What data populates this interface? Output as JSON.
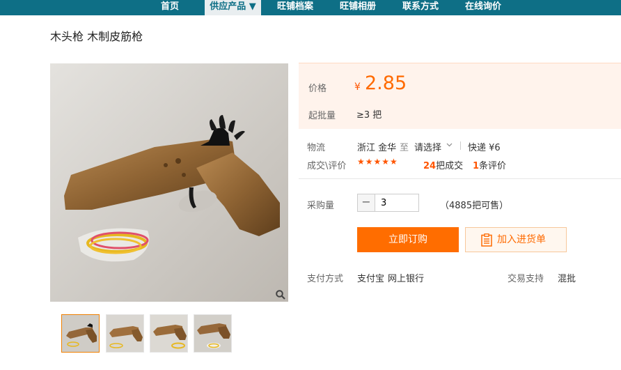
{
  "nav": {
    "items": [
      {
        "label": "首页"
      },
      {
        "label": "供应产品 ▼"
      },
      {
        "label": "旺铺档案"
      },
      {
        "label": "旺铺相册"
      },
      {
        "label": "联系方式"
      },
      {
        "label": "在线询价"
      }
    ],
    "active_index": 1
  },
  "product": {
    "title": "木头枪 木制皮筋枪"
  },
  "price": {
    "label": "价格",
    "currency": "¥",
    "value": "2.85",
    "moq_label": "起批量",
    "moq_value": "≥3 把"
  },
  "logistics": {
    "label": "物流",
    "from": "浙江 金华",
    "to_word": "至",
    "select_placeholder": "请选择",
    "shipping": "快递 ¥6"
  },
  "deals": {
    "label": "成交\\评价",
    "rating_stars": 5,
    "stars_text": "★★★★★",
    "sold_count": "24",
    "sold_suffix": "把成交",
    "review_count": "1",
    "review_suffix": "条评价"
  },
  "purchase": {
    "qty_label": "采购量",
    "qty_minus": "−",
    "qty_value": "3",
    "stock": "（4885把可售）",
    "buy_button": "立即订购",
    "cart_button": "加入进货单"
  },
  "payment": {
    "label": "支付方式",
    "methods": "支付宝",
    "methods2": "网上银行",
    "support_label": "交易支持",
    "support_value": "混批"
  },
  "colors": {
    "nav_bg": "#0e6f86",
    "accent": "#ff6d00",
    "price": "#ff6a00"
  }
}
